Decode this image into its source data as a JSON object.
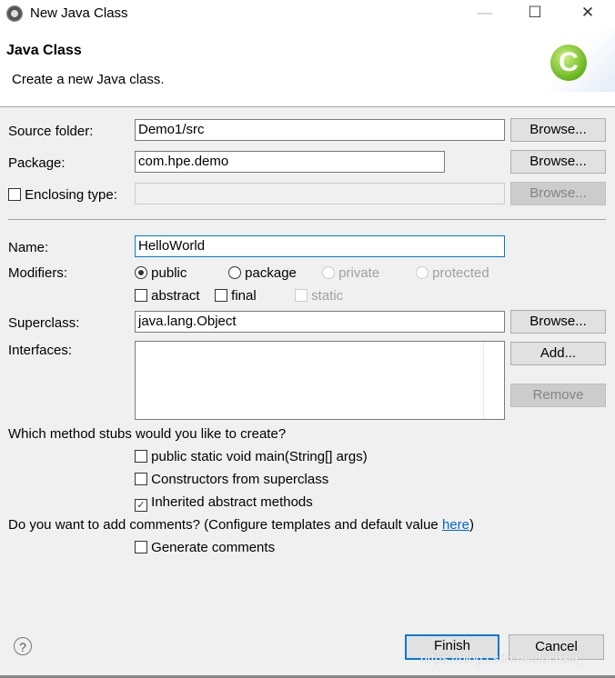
{
  "window": {
    "title": "New Java Class",
    "minimize_icon": "minimize-icon",
    "maximize_icon": "maximize-icon",
    "close_icon": "close-icon"
  },
  "banner": {
    "title": "Java Class",
    "description": "Create a new Java class.",
    "icon": "java-class-icon",
    "icon_glyph": "C"
  },
  "form": {
    "source_folder": {
      "label": "Source folder:",
      "value": "Demo1/src",
      "browse": "Browse..."
    },
    "package": {
      "label": "Package:",
      "value": "com.hpe.demo",
      "browse": "Browse..."
    },
    "enclosing_type": {
      "label": "Enclosing type:",
      "checked": false,
      "value": "",
      "browse": "Browse..."
    },
    "name": {
      "label": "Name:",
      "value": "HelloWorld"
    },
    "modifiers": {
      "label": "Modifiers:",
      "radios": [
        {
          "label": "public",
          "checked": true,
          "enabled": true
        },
        {
          "label": "package",
          "checked": false,
          "enabled": true
        },
        {
          "label": "private",
          "checked": false,
          "enabled": false
        },
        {
          "label": "protected",
          "checked": false,
          "enabled": false
        }
      ],
      "checkboxes": [
        {
          "label": "abstract",
          "checked": false,
          "enabled": true
        },
        {
          "label": "final",
          "checked": false,
          "enabled": true
        },
        {
          "label": "static",
          "checked": false,
          "enabled": false
        }
      ]
    },
    "superclass": {
      "label": "Superclass:",
      "value": "java.lang.Object",
      "browse": "Browse..."
    },
    "interfaces": {
      "label": "Interfaces:",
      "items": [],
      "add": "Add...",
      "remove": "Remove"
    },
    "stubs": {
      "question": "Which method stubs would you like to create?",
      "options": [
        {
          "label": "public static void main(String[] args)",
          "checked": false
        },
        {
          "label": "Constructors from superclass",
          "checked": false
        },
        {
          "label": "Inherited abstract methods",
          "checked": true
        }
      ]
    },
    "comments": {
      "question_prefix": "Do you want to add comments? (Configure templates and default value ",
      "link": "here",
      "question_suffix": ")",
      "option": {
        "label": "Generate comments",
        "checked": false
      }
    }
  },
  "footer": {
    "help_icon": "help-icon",
    "help_glyph": "?",
    "finish": "Finish",
    "cancel": "Cancel"
  },
  "watermark": "https://blog.csdn.net/fuchsia_"
}
